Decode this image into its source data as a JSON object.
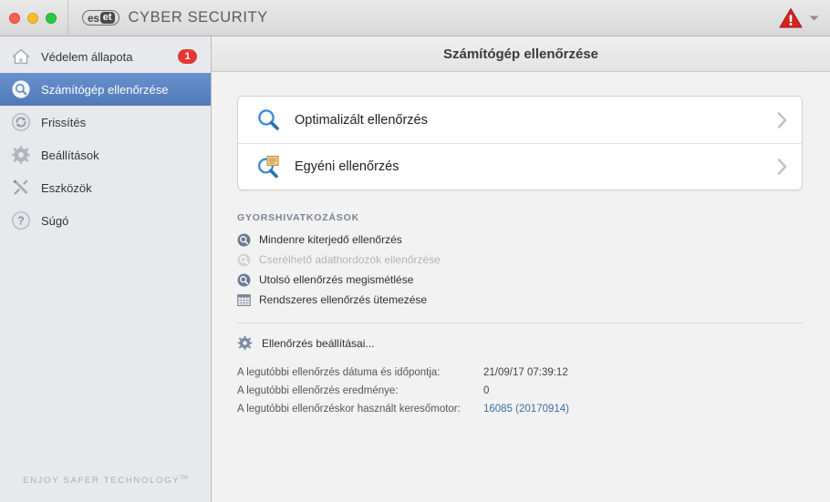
{
  "window": {
    "brand_mark": "eset",
    "brand_mark_part1": "es",
    "brand_mark_part2": "et",
    "brand_name": "CYBER SECURITY",
    "status_icon": "warning-triangle-icon",
    "status_dropdown_icon": "chevron-down-icon"
  },
  "sidebar": {
    "items": [
      {
        "label": "Védelem állapota",
        "icon": "home-icon",
        "badge": "1",
        "selected": false
      },
      {
        "label": "Számítógép ellenőrzése",
        "icon": "magnifier-circle-icon",
        "badge": "",
        "selected": true
      },
      {
        "label": "Frissítés",
        "icon": "refresh-circle-icon",
        "badge": "",
        "selected": false
      },
      {
        "label": "Beállítások",
        "icon": "gear-icon",
        "badge": "",
        "selected": false
      },
      {
        "label": "Eszközök",
        "icon": "tools-icon",
        "badge": "",
        "selected": false
      },
      {
        "label": "Súgó",
        "icon": "question-circle-icon",
        "badge": "",
        "selected": false
      }
    ],
    "tagline": "ENJOY SAFER TECHNOLOGY",
    "tagline_tm": "TM"
  },
  "header": {
    "title": "Számítógép ellenőrzése"
  },
  "scan_options": [
    {
      "label": "Optimalizált ellenőrzés",
      "icon": "magnifier-icon",
      "chevron": "chevron-right-icon"
    },
    {
      "label": "Egyéni ellenőrzés",
      "icon": "magnifier-document-icon",
      "chevron": "chevron-right-icon"
    }
  ],
  "quick_links": {
    "heading": "GYORSHIVATKOZÁSOK",
    "items": [
      {
        "label": "Mindenre kiterjedő ellenőrzés",
        "icon": "magnifier-circle-icon",
        "disabled": false
      },
      {
        "label": "Cserélhető adathordozók ellenőrzése",
        "icon": "magnifier-circle-icon",
        "disabled": true
      },
      {
        "label": "Utolsó ellenőrzés megismétlése",
        "icon": "magnifier-circle-icon",
        "disabled": false
      },
      {
        "label": "Rendszeres ellenőrzés ütemezése",
        "icon": "calendar-icon",
        "disabled": false
      }
    ]
  },
  "settings_link": {
    "label": "Ellenőrzés beállításai...",
    "icon": "gear-icon"
  },
  "info_rows": [
    {
      "key": "A legutóbbi ellenőrzés dátuma és időpontja:",
      "value": "21/09/17 07:39:12",
      "is_link": false
    },
    {
      "key": "A legutóbbi ellenőrzés eredménye:",
      "value": "0",
      "is_link": false
    },
    {
      "key": "A legutóbbi ellenőrzéskor használt keresőmotor:",
      "value": "16085 (20170914)",
      "is_link": true
    }
  ],
  "colors": {
    "selection_blue": "#5179ba",
    "badge_red": "#e23a33",
    "link_blue": "#3a6ea5",
    "sidebar_bg": "#e8e9ec",
    "content_bg": "#f2f2f2"
  }
}
